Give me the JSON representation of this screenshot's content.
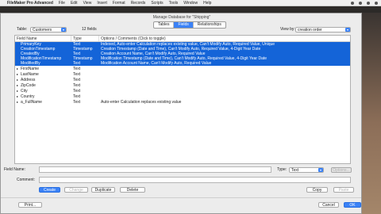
{
  "menubar": {
    "apple": "",
    "app": "FileMaker Pro Advanced",
    "items": [
      "File",
      "Edit",
      "View",
      "Insert",
      "Format",
      "Records",
      "Scripts",
      "Tools",
      "Window",
      "Help"
    ]
  },
  "dialog": {
    "title": "Manage Database for \"Shipping\"",
    "tabs": [
      "Tables",
      "Fields",
      "Relationships"
    ],
    "active_tab": "Fields",
    "table_label": "Table:",
    "table_value": "Customers",
    "field_count": "12 fields",
    "view_label": "View by:",
    "view_value": "creation order"
  },
  "columns": [
    "Field Name",
    "Type",
    "Options / Comments  (Click to toggle)"
  ],
  "rows": [
    {
      "arrow": "",
      "name": "PrimaryKey",
      "type": "Text",
      "options": "Indexed, Auto-enter Calculation replaces existing value, Can't Modify Auto, Required Value, Unique",
      "selected": true
    },
    {
      "arrow": "",
      "name": "CreationTimestamp",
      "type": "Timestamp",
      "options": "Creation Timestamp (Date and Time), Can't Modify Auto, Required Value, 4-Digit Year Date",
      "selected": true
    },
    {
      "arrow": "",
      "name": "CreatedBy",
      "type": "Text",
      "options": "Creation Account Name, Can't Modify Auto, Required Value",
      "selected": true
    },
    {
      "arrow": "",
      "name": "ModificationTimestamp",
      "type": "Timestamp",
      "options": "Modification Timestamp (Date and Time), Can't Modify Auto, Required Value, 4-Digit Year Date",
      "selected": true
    },
    {
      "arrow": "",
      "name": "ModifiedBy",
      "type": "Text",
      "options": "Modification Account Name, Can't Modify Auto, Required Value",
      "selected": true
    },
    {
      "arrow": "▸",
      "name": "FirstName",
      "type": "Text",
      "options": "",
      "selected": false
    },
    {
      "arrow": "▸",
      "name": "LastName",
      "type": "Text",
      "options": "",
      "selected": false
    },
    {
      "arrow": "▸",
      "name": "Address",
      "type": "Text",
      "options": "",
      "selected": false
    },
    {
      "arrow": "▸",
      "name": "ZipCode",
      "type": "Text",
      "options": "",
      "selected": false
    },
    {
      "arrow": "▸",
      "name": "City",
      "type": "Text",
      "options": "",
      "selected": false
    },
    {
      "arrow": "▸",
      "name": "Country",
      "type": "Text",
      "options": "",
      "selected": false
    },
    {
      "arrow": "▸",
      "name": "a_FullName",
      "type": "Text",
      "options": "Auto-enter Calculation replaces existing value",
      "selected": false
    }
  ],
  "editor": {
    "field_name_label": "Field Name:",
    "field_name_value": "",
    "type_label": "Type:",
    "type_value": "Text",
    "options_button": "Options...",
    "comment_label": "Comment:",
    "comment_value": "",
    "create": "Create",
    "change": "Change",
    "duplicate": "Duplicate",
    "delete": "Delete",
    "copy": "Copy",
    "paste": "Paste",
    "print": "Print...",
    "cancel": "Cancel",
    "ok": "OK"
  },
  "colors": {
    "accent": "#3b82f6",
    "selection": "#1464d8"
  }
}
